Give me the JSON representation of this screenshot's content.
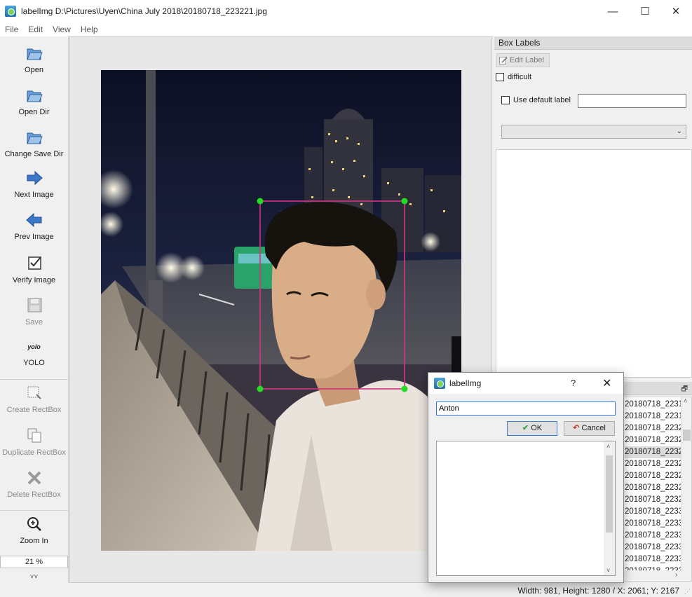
{
  "window": {
    "title": "labelImg D:\\Pictures\\Uyen\\China July 2018\\20180718_223221.jpg",
    "minimize_glyph": "—",
    "maximize_glyph": "☐",
    "close_glyph": "✕"
  },
  "menu": [
    "File",
    "Edit",
    "View",
    "Help"
  ],
  "toolbar": {
    "open": "Open",
    "open_dir": "Open Dir",
    "change_save_dir": "Change Save Dir",
    "next_image": "Next Image",
    "prev_image": "Prev Image",
    "verify_image": "Verify Image",
    "save": "Save",
    "yolo_icon_text": "yolo",
    "yolo": "YOLO",
    "create_rectbox": "Create RectBox",
    "duplicate_rectbox": "Duplicate RectBox",
    "delete_rectbox": "Delete RectBox",
    "zoom_in": "Zoom In",
    "zoom_level": "21 %",
    "more_glyph": "˅˅"
  },
  "box_labels_panel": {
    "title": "Box Labels",
    "edit_label_button": "Edit Label",
    "difficult_label": "difficult",
    "difficult_checked": false,
    "use_default_label": "Use default label",
    "use_default_checked": false,
    "default_label_value": "",
    "combo_value": ""
  },
  "file_list": {
    "float_glyph": "🗗",
    "selected_index": 4,
    "items": [
      "20180718_2231",
      "20180718_2231",
      "20180718_2232",
      "20180718_2232",
      "20180718_2232",
      "20180718_2232",
      "20180718_2232",
      "20180718_2232",
      "20180718_2232",
      "20180718_2233",
      "20180718_2233",
      "20180718_2233",
      "20180718_2233",
      "20180718_2233",
      "20180718_2233"
    ]
  },
  "status": {
    "text": "Width: 981, Height: 1280 / X: 2061; Y: 2167"
  },
  "dialog": {
    "title": "labelImg",
    "help_glyph": "?",
    "close_glyph": "✕",
    "input_value": "Anton",
    "ok_label": "OK",
    "cancel_label": "Cancel",
    "items": []
  },
  "colors": {
    "bbox": "#d63384",
    "handle": "#22dd22",
    "accent": "#3a7bd5"
  }
}
